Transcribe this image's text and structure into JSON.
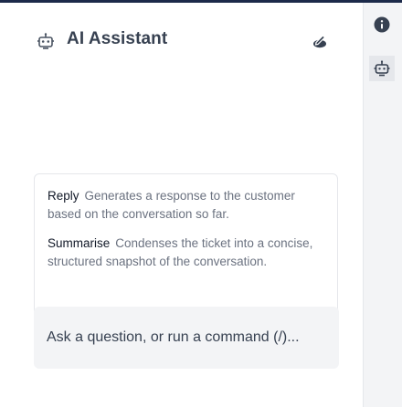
{
  "header": {
    "title": "AI Assistant",
    "icon": "robot-icon",
    "settings_icon": "pencil-badge-icon"
  },
  "suggestions": [
    {
      "command": "Reply",
      "description": "Generates a response to the customer based on the conversation so far."
    },
    {
      "command": "Summarise",
      "description": "Condenses the ticket into a concise, structured snapshot of the conversation."
    }
  ],
  "input": {
    "placeholder": "Ask a question, or run a command (/)..."
  },
  "rail": {
    "items": [
      {
        "icon": "info-icon"
      },
      {
        "icon": "robot-icon"
      }
    ]
  },
  "colors": {
    "topbar": "#1c2a4a",
    "title": "#374151",
    "command": "#111827",
    "description": "#6b7280",
    "input_bg": "#f3f4f6"
  }
}
